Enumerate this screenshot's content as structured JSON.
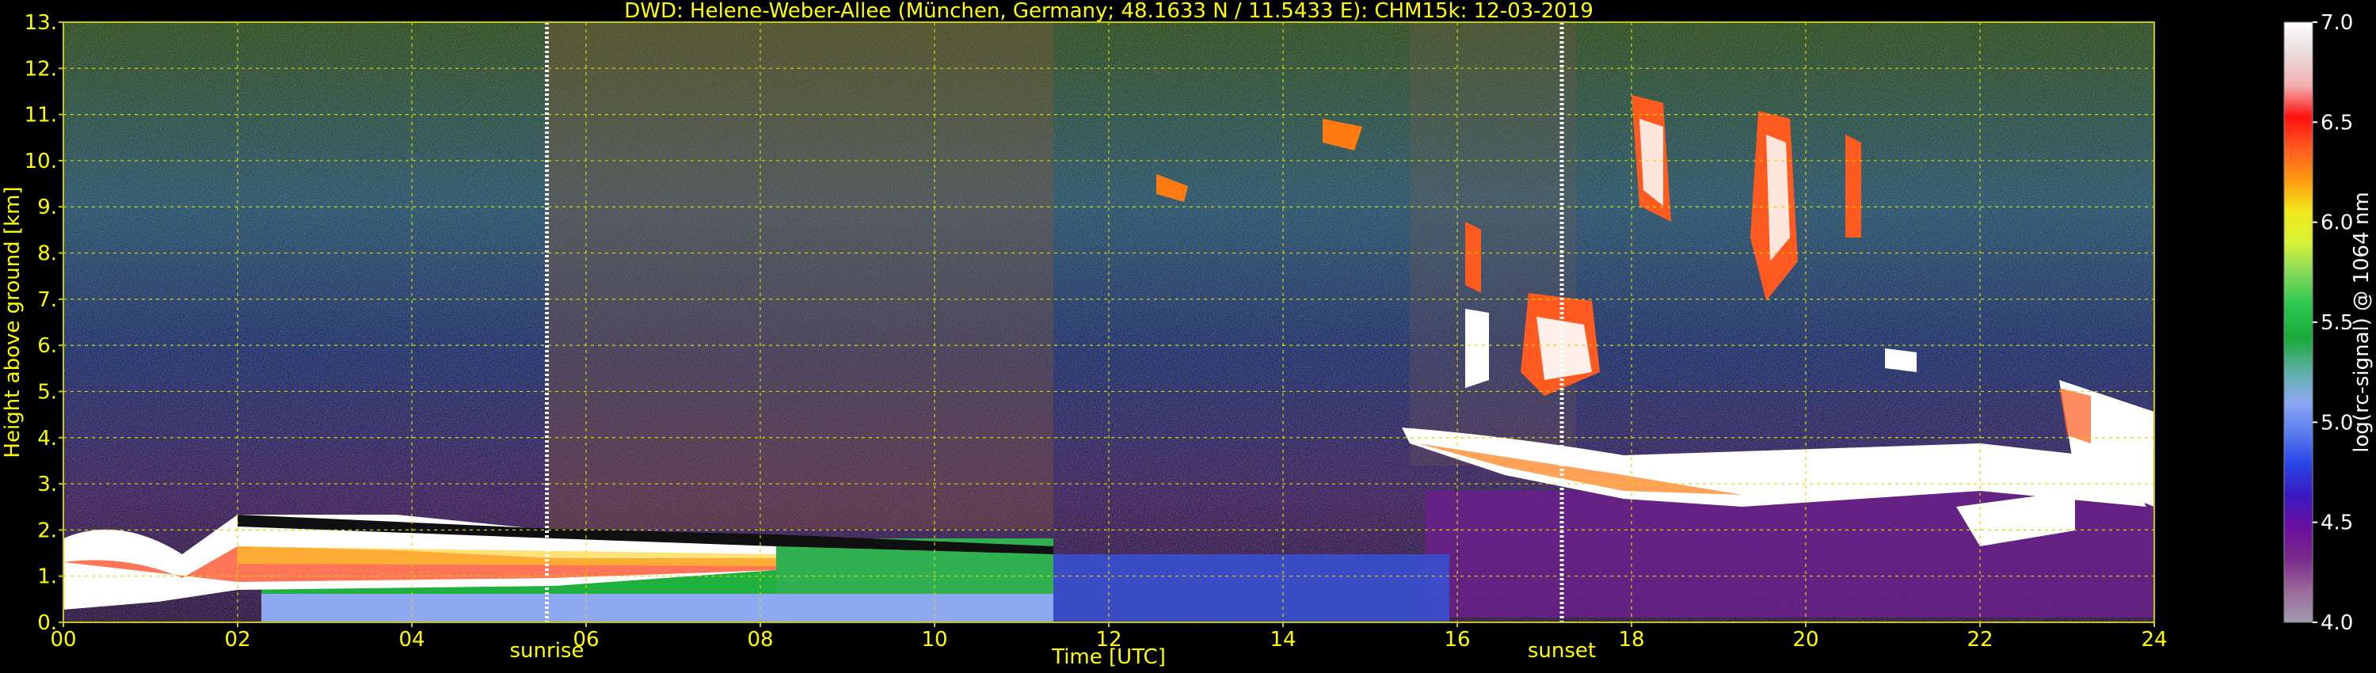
{
  "chart_data": {
    "type": "heatmap",
    "title": "DWD: Helene-Weber-Allee (München, Germany; 48.1633 N / 11.5433 E):    CHM15k: 12-03-2019",
    "xlabel": "Time [UTC]",
    "ylabel": "Height above ground [km]",
    "x_ticks": [
      "00",
      "02",
      "04",
      "06",
      "08",
      "10",
      "12",
      "14",
      "16",
      "18",
      "20",
      "22",
      "24"
    ],
    "y_ticks": [
      "0.",
      "1.",
      "2.",
      "3.",
      "4.",
      "5.",
      "6.",
      "7.",
      "8.",
      "9.",
      "10.",
      "11.",
      "12.",
      "13."
    ],
    "xlim": [
      0,
      24
    ],
    "ylim": [
      0,
      13
    ],
    "grid": true,
    "colorbar": {
      "label": "log(rc-signal) @ 1064 nm",
      "ticks": [
        "4.0",
        "4.5",
        "5.0",
        "5.5",
        "6.0",
        "6.5",
        "7.0"
      ],
      "range": [
        4.0,
        7.0
      ],
      "colors": [
        "#a09ab0",
        "#9a6a9a",
        "#7a2a8a",
        "#6a10a0",
        "#3a18c0",
        "#2a44e8",
        "#5a7cf0",
        "#8fa8f2",
        "#5ab0a0",
        "#1aa83a",
        "#28c850",
        "#7ed85a",
        "#d6f23a",
        "#f0e81a",
        "#ff9a10",
        "#ff5a20",
        "#ff1010",
        "#f4b0b0",
        "#e8dada",
        "#ffffff"
      ]
    },
    "events": [
      {
        "label": "sunrise",
        "x": 5.55
      },
      {
        "label": "sunset",
        "x": 17.2
      }
    ]
  }
}
